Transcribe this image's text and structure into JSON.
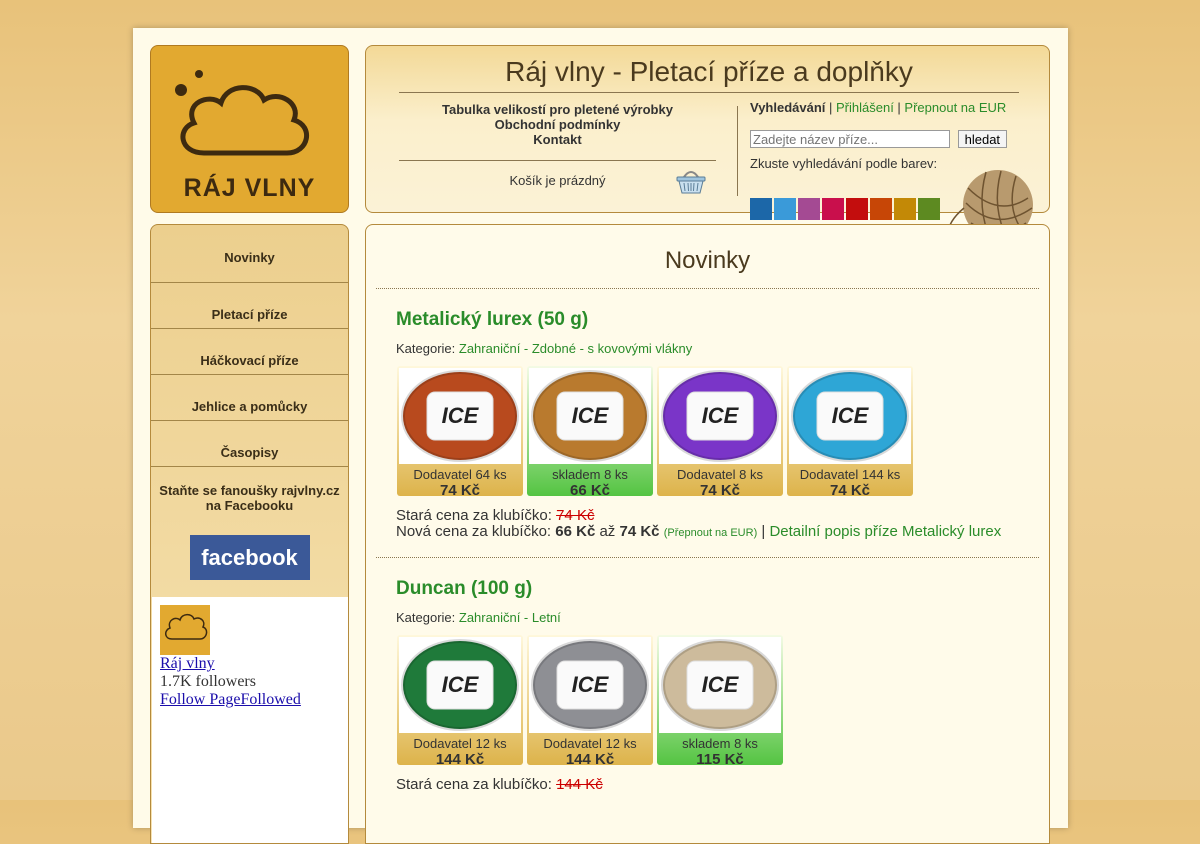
{
  "logo": {
    "text": "RÁJ VLNY"
  },
  "header": {
    "title": "Ráj vlny - Pletací příze a doplňky",
    "links": [
      "Tabulka velikostí pro pletené výrobky",
      "Obchodní podmínky",
      "Kontakt"
    ],
    "cart_status": "Košík je prázdný",
    "search": {
      "label": "Vyhledávání",
      "login": "Přihlášení",
      "switch_currency": "Přepnout na EUR",
      "placeholder": "Zadejte název příze...",
      "button": "hledat",
      "color_hint": "Zkuste vyhledávání podle barev:",
      "colors": [
        "#1c67a8",
        "#3a9ad9",
        "#a44a93",
        "#c90f4c",
        "#c30d0d",
        "#c74606",
        "#c38906",
        "#5d8a21"
      ]
    }
  },
  "nav": {
    "items": [
      "Novinky",
      "Pletací příze",
      "Háčkovací příze",
      "Jehlice a pomůcky",
      "Časopisy"
    ],
    "facebook_text": "Staňte se fanoušky rajvlny.cz na Facebooku",
    "facebook_button": "facebook",
    "widget": {
      "page_name": "Ráj vlny",
      "followers": "1.7K followers",
      "follow": "Follow PageFollowed"
    }
  },
  "main": {
    "heading": "Novinky",
    "products": [
      {
        "name": "Metalický lurex (50 g)",
        "category_label": "Kategorie:",
        "category": "Zahraniční - Zdobné - s kovovými vlákny",
        "tiles": [
          {
            "stock": "Dodavatel 64 ks",
            "price": "74 Kč",
            "type": "supplier",
            "color": "#b84a1e"
          },
          {
            "stock": "skladem 8 ks",
            "price": "66 Kč",
            "type": "stocked",
            "color": "#b97a2e"
          },
          {
            "stock": "Dodavatel 8 ks",
            "price": "74 Kč",
            "type": "supplier",
            "color": "#7a35c8"
          },
          {
            "stock": "Dodavatel 144 ks",
            "price": "74 Kč",
            "type": "supplier",
            "color": "#2ea6d6"
          }
        ],
        "old_price_label": "Stará cena za klubíčko:",
        "old_price": "74 Kč",
        "new_price_label": "Nová cena za klubíčko:",
        "new_price_from": "66 Kč",
        "range_word": "až",
        "new_price_to": "74 Kč",
        "switch_currency": "(Přepnout na EUR)",
        "detail_link": "Detailní popis příze Metalický lurex"
      },
      {
        "name": "Duncan (100 g)",
        "category_label": "Kategorie:",
        "category": "Zahraniční - Letní",
        "tiles": [
          {
            "stock": "Dodavatel 12 ks",
            "price": "144 Kč",
            "type": "supplier",
            "color": "#1f7a3a"
          },
          {
            "stock": "Dodavatel 12 ks",
            "price": "144 Kč",
            "type": "supplier",
            "color": "#8e8f94"
          },
          {
            "stock": "skladem 8 ks",
            "price": "115 Kč",
            "type": "stocked",
            "color": "#cdbb9c"
          }
        ],
        "old_price_label": "Stará cena za klubíčko:",
        "old_price": "144 Kč"
      }
    ]
  }
}
